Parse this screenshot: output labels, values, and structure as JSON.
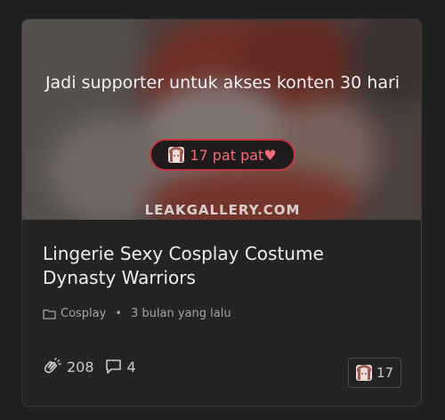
{
  "post": {
    "lock_message": "Jadi supporter untuk akses konten 30 hari",
    "pat_label": "17 pat pat♥",
    "watermark": "LEAKGALLERY.COM",
    "title": "Lingerie Sexy Cosplay Costume Dynasty Warriors",
    "category": "Cosplay",
    "separator": "•",
    "posted_ago": "3 bulan yang lalu",
    "likes": "208",
    "comments": "4",
    "supporters": "17"
  },
  "icons": {
    "pat": "avatar-icon",
    "category": "folder-icon",
    "likes": "hand-clap-icon",
    "comments": "comment-icon"
  },
  "colors": {
    "background": "#202020",
    "card": "#242424",
    "accent": "#c5353f",
    "accent_text": "#ef6f74",
    "text": "#ededed",
    "muted": "#a4a4a4"
  }
}
